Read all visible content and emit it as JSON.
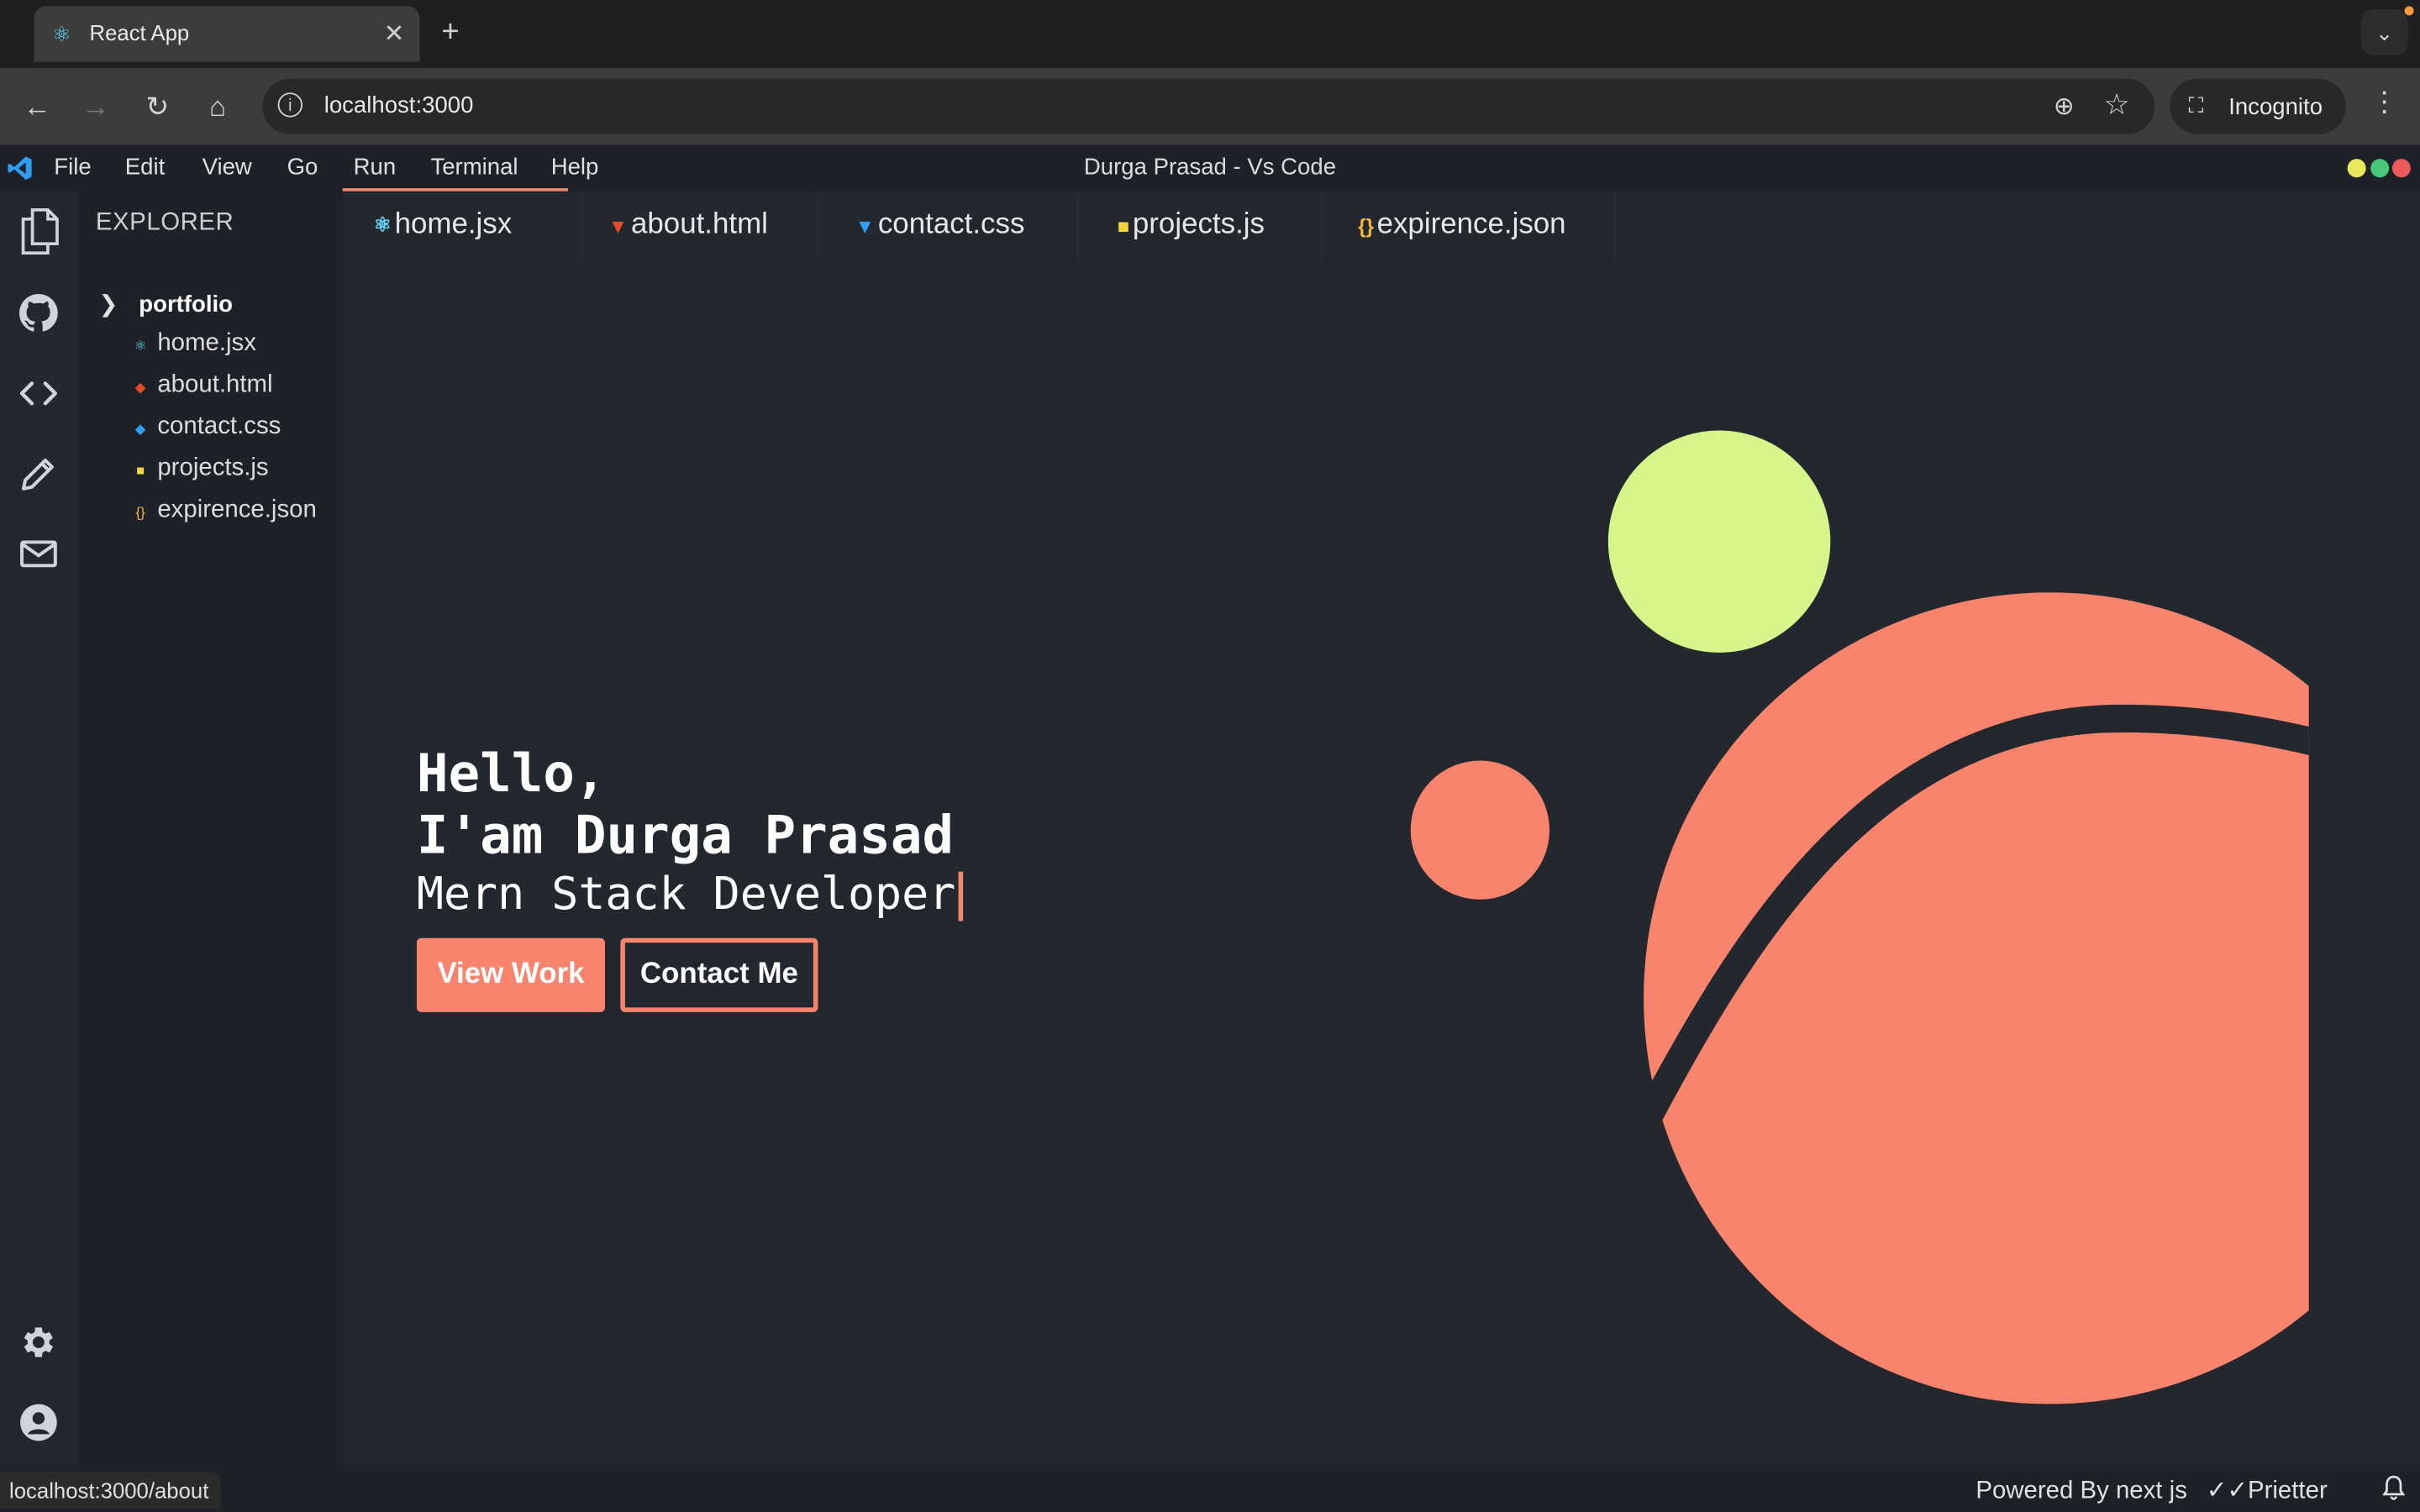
{
  "browser": {
    "tab_title": "React App",
    "url": "localhost:3000",
    "incognito_label": "Incognito"
  },
  "window": {
    "title": "Durga Prasad - Vs Code"
  },
  "menu": {
    "items": [
      "File",
      "Edit",
      "View",
      "Go",
      "Run",
      "Terminal",
      "Help"
    ],
    "active": "Run"
  },
  "sidebar": {
    "title": "EXPLORER",
    "folder": "portfolio",
    "files": [
      {
        "name": "home.jsx",
        "icon": "react-icon"
      },
      {
        "name": "about.html",
        "icon": "html5-icon"
      },
      {
        "name": "contact.css",
        "icon": "css3-icon"
      },
      {
        "name": "projects.js",
        "icon": "js-icon"
      },
      {
        "name": "expirence.json",
        "icon": "json-icon"
      }
    ]
  },
  "tabs": [
    "home.jsx",
    "about.html",
    "contact.css",
    "projects.js",
    "expirence.json"
  ],
  "hero": {
    "line1": "Hello,",
    "line2": "I'am Durga Prasad",
    "line3": "Mern Stack Developer",
    "primary_button": "View Work",
    "secondary_button": "Contact Me"
  },
  "status": {
    "link_preview": "localhost:3000/about",
    "right_text": "Powered By next js",
    "prettier": "Prietter"
  },
  "colors": {
    "accent": "#f8846d",
    "green": "#d6f58a",
    "background": "#23272e"
  }
}
